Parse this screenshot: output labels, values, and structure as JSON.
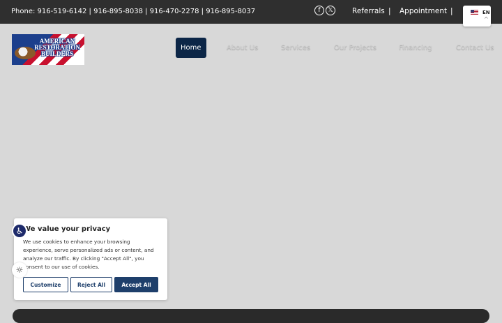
{
  "topbar": {
    "phone_text": "Phone: 916-519-6142 | 916-895-8038 | 916-470-2278 | 916-895-8037",
    "social": [
      {
        "icon": "facebook-icon",
        "glyph": "f"
      },
      {
        "icon": "x-twitter-icon",
        "glyph": "𝕏"
      }
    ],
    "links": {
      "referrals": "Referrals",
      "separator": "|",
      "appointment": "Appointment"
    },
    "language": {
      "code": "EN",
      "caret": "^"
    }
  },
  "logo": {
    "text": "AMERICAN RESTORATION BUILDERS"
  },
  "nav": {
    "items": [
      {
        "label": "Home",
        "active": true
      },
      {
        "label": "About Us"
      },
      {
        "label": "Services"
      },
      {
        "label": "Our Projects"
      },
      {
        "label": "Financing"
      },
      {
        "label": "Contact Us"
      }
    ]
  },
  "widgets": {
    "accessibility_glyph": "♿",
    "contrast_glyph": "☼"
  },
  "cookie": {
    "title": "We value your privacy",
    "text": "We use cookies to enhance your browsing experience, serve personalized ads or content, and analyze our traffic. By clicking \"Accept All\", you consent to our use of cookies.",
    "customize": "Customize",
    "reject": "Reject All",
    "accept": "Accept All"
  },
  "colors": {
    "topbar": "#2f2f2f",
    "nav_active": "#0c2647",
    "button": "#1e3f6b"
  }
}
